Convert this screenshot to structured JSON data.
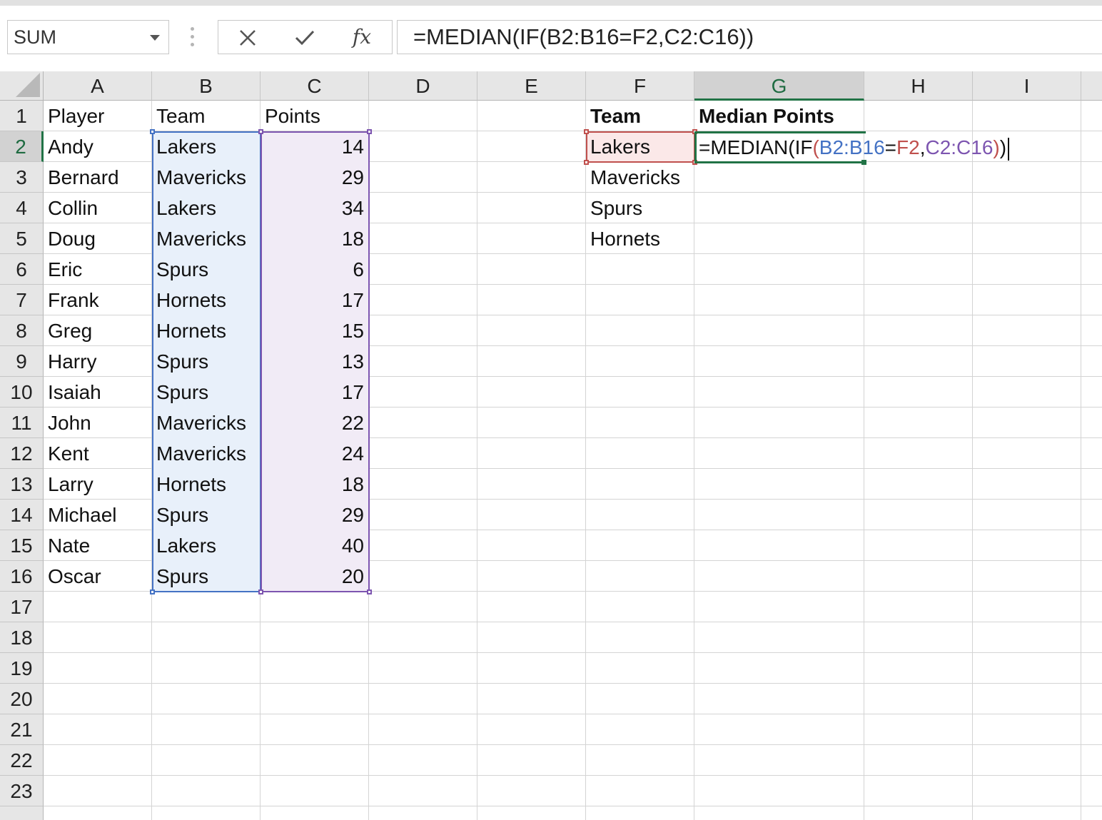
{
  "name_box": {
    "value": "SUM"
  },
  "formula_bar": {
    "cancel_icon": "close-icon",
    "enter_icon": "check-icon",
    "fx_label": "fx",
    "formula": "=MEDIAN(IF(B2:B16=F2,C2:C16))"
  },
  "columns": [
    "A",
    "B",
    "C",
    "D",
    "E",
    "F",
    "G",
    "H",
    "I"
  ],
  "active_column": "G",
  "rows": [
    "1",
    "2",
    "3",
    "4",
    "5",
    "6",
    "7",
    "8",
    "9",
    "10",
    "11",
    "12",
    "13",
    "14",
    "15",
    "16",
    "17",
    "18",
    "19",
    "20",
    "21",
    "22",
    "23"
  ],
  "active_row": "2",
  "table": {
    "headers": {
      "player": "Player",
      "team": "Team",
      "points": "Points"
    },
    "records": [
      {
        "player": "Andy",
        "team": "Lakers",
        "points": "14"
      },
      {
        "player": "Bernard",
        "team": "Mavericks",
        "points": "29"
      },
      {
        "player": "Collin",
        "team": "Lakers",
        "points": "34"
      },
      {
        "player": "Doug",
        "team": "Mavericks",
        "points": "18"
      },
      {
        "player": "Eric",
        "team": "Spurs",
        "points": "6"
      },
      {
        "player": "Frank",
        "team": "Hornets",
        "points": "17"
      },
      {
        "player": "Greg",
        "team": "Hornets",
        "points": "15"
      },
      {
        "player": "Harry",
        "team": "Spurs",
        "points": "13"
      },
      {
        "player": "Isaiah",
        "team": "Spurs",
        "points": "17"
      },
      {
        "player": "John",
        "team": "Mavericks",
        "points": "22"
      },
      {
        "player": "Kent",
        "team": "Mavericks",
        "points": "24"
      },
      {
        "player": "Larry",
        "team": "Hornets",
        "points": "18"
      },
      {
        "player": "Michael",
        "team": "Spurs",
        "points": "29"
      },
      {
        "player": "Nate",
        "team": "Lakers",
        "points": "40"
      },
      {
        "player": "Oscar",
        "team": "Spurs",
        "points": "20"
      }
    ]
  },
  "summary": {
    "team_header": "Team",
    "median_header": "Median Points",
    "teams": [
      "Lakers",
      "Mavericks",
      "Spurs",
      "Hornets"
    ]
  },
  "editing_cell": {
    "ref": "G2",
    "tokens": {
      "prefix": "=MEDIAN(IF",
      "open_paren": "(",
      "range_b": "B2:B16",
      "equals": "=",
      "ref_f": "F2",
      "comma": ",",
      "range_c": "C2:C16",
      "close_paren": ")",
      "final_paren": ")"
    }
  },
  "colors": {
    "excel_green": "#217346",
    "range_b": "#4472c4",
    "range_c": "#7d55b0",
    "ref_f": "#c0504d"
  }
}
